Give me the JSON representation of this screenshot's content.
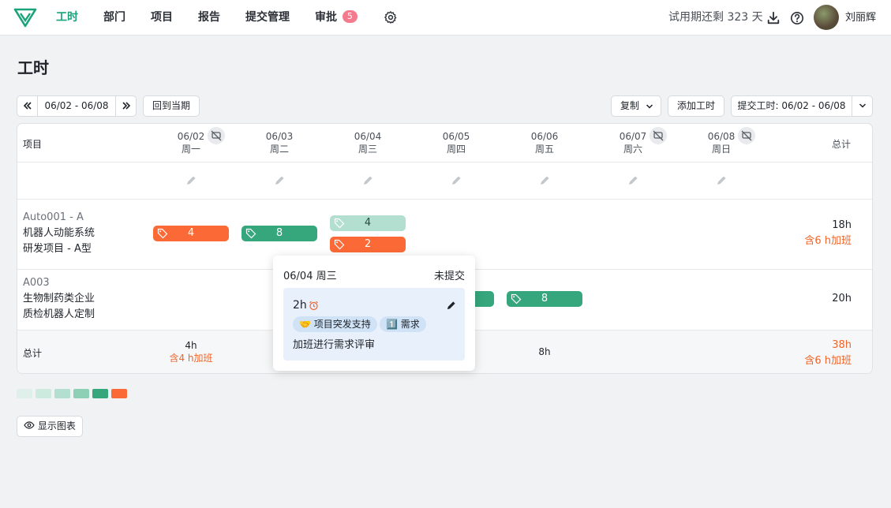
{
  "nav": {
    "items": [
      {
        "label": "工时"
      },
      {
        "label": "部门"
      },
      {
        "label": "项目"
      },
      {
        "label": "报告"
      },
      {
        "label": "提交管理"
      },
      {
        "label": "审批",
        "badge": "5"
      }
    ],
    "trial_text": "试用期还剩 323 天",
    "username": "刘丽辉"
  },
  "page": {
    "title": "工时"
  },
  "toolbar": {
    "range": "06/02 - 06/08",
    "current_period": "回到当期",
    "copy": "复制",
    "add_hours": "添加工时",
    "submit": "提交工时: 06/02 - 06/08"
  },
  "table": {
    "project_header": "项目",
    "total_header": "总计",
    "days": [
      {
        "date": "06/02",
        "weekday": "周一"
      },
      {
        "date": "06/03",
        "weekday": "周二"
      },
      {
        "date": "06/04",
        "weekday": "周三"
      },
      {
        "date": "06/05",
        "weekday": "周四"
      },
      {
        "date": "06/06",
        "weekday": "周五"
      },
      {
        "date": "06/07",
        "weekday": "周六"
      },
      {
        "date": "06/08",
        "weekday": "周日"
      }
    ],
    "rows": [
      {
        "code": "Auto001 - A",
        "client": "机器人动能系统",
        "name": "研发项目 - A型",
        "cells": [
          "4",
          "8",
          "4",
          "2"
        ],
        "total": "18h",
        "overtime": "含6 h加班"
      },
      {
        "code": "A003",
        "client": "生物制药类企业",
        "name": "质检机器人定制",
        "cells": [
          "8"
        ],
        "total": "20h"
      }
    ],
    "footer": {
      "label": "总计",
      "day1_total": "4h",
      "day1_overtime": "含4 h加班",
      "day5_total": "8h",
      "grand_total": "38h",
      "grand_overtime": "含6 h加班"
    }
  },
  "popup": {
    "date": "06/04 周三",
    "status": "未提交",
    "hours": "2h",
    "tag1": "🤝 项目突发支持",
    "tag2": "1️⃣ 需求",
    "note": "加班进行需求评审"
  },
  "show_chart": "显示图表",
  "colors": {
    "accent": "#1aa37a",
    "overtime": "#fb6a36",
    "hours": "#36a67c"
  },
  "legend_colors": [
    "#dff0ea",
    "#cdeadf",
    "#b2dfcf",
    "#8dd0b6",
    "#36a67c",
    "#fb6a36"
  ]
}
